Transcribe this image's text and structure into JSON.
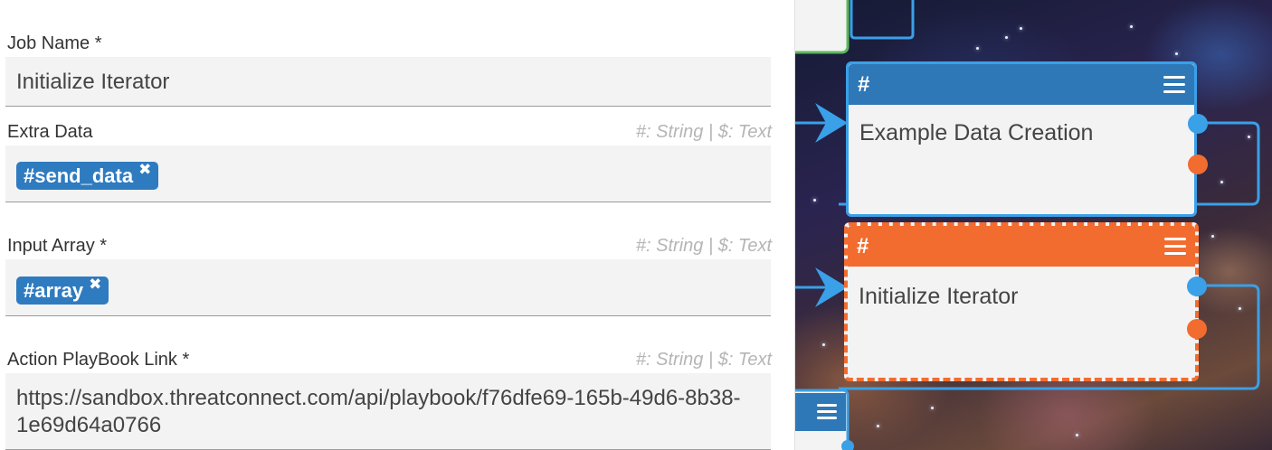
{
  "form": {
    "job_name": {
      "label": "Job Name *",
      "value": "Initialize Iterator"
    },
    "extra_data": {
      "label": "Extra Data",
      "hint": "#: String  |  $: Text",
      "tags": [
        "#send_data"
      ]
    },
    "input_array": {
      "label": "Input Array *",
      "hint": "#: String  |  $: Text",
      "tags": [
        "#array"
      ]
    },
    "playbook_link": {
      "label": "Action PlayBook Link *",
      "hint": "#: String  |  $: Text",
      "value": "https://sandbox.threatconnect.com/api/playbook/f76dfe69-165b-49d6-8b38-1e69d64a0766"
    }
  },
  "tag_remove_glyph": "✖",
  "canvas": {
    "nodes": [
      {
        "head_glyph": "#",
        "title": "Example Data Creation",
        "head_color": "#2e78b8",
        "border_color": "#3aa0e8",
        "state": "normal"
      },
      {
        "head_glyph": "#",
        "title": "Initialize Iterator",
        "head_color": "#f26c2f",
        "border_color": "#f26c2f",
        "state": "selected"
      }
    ],
    "accent_blue": "#2f7bc0",
    "accent_orange": "#f26c2f"
  }
}
